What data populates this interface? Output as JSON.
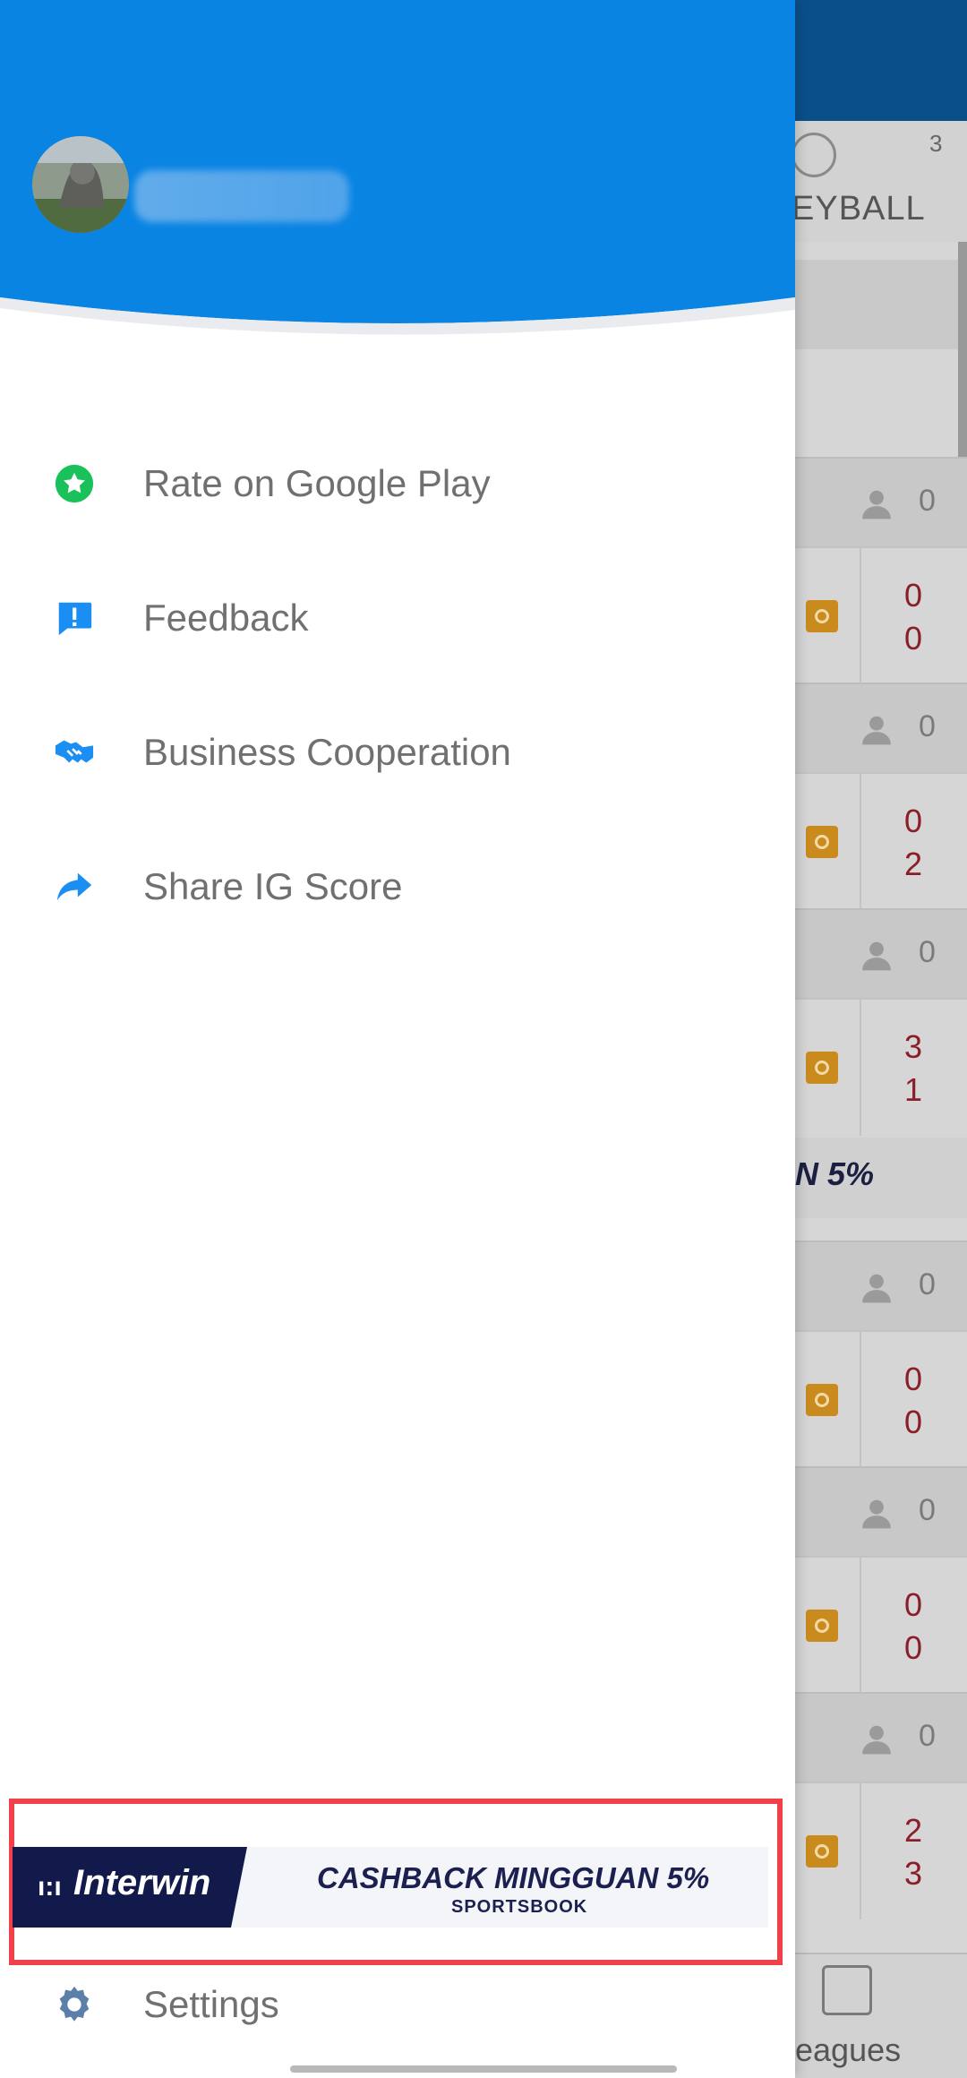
{
  "background": {
    "tab": {
      "label": "EYBALL",
      "count": "3"
    },
    "rows": [
      {
        "viewers": "0",
        "score_home": "0",
        "score_away": "0"
      },
      {
        "viewers": "0",
        "score_home": "0",
        "score_away": "2"
      },
      {
        "viewers": "0",
        "score_home": "3",
        "score_away": "1"
      },
      {
        "viewers": "0",
        "score_home": "0",
        "score_away": "0"
      },
      {
        "viewers": "0",
        "score_home": "0",
        "score_away": "0"
      },
      {
        "viewers": "0",
        "score_home": "2",
        "score_away": "3"
      }
    ],
    "ad_fragment": "N 5%",
    "bottom_nav_label": "eagues"
  },
  "drawer": {
    "menu": [
      {
        "label": "Rate on Google Play",
        "icon": "star-badge-icon"
      },
      {
        "label": "Feedback",
        "icon": "feedback-icon"
      },
      {
        "label": "Business Cooperation",
        "icon": "handshake-icon"
      },
      {
        "label": "Share IG Score",
        "icon": "share-icon"
      }
    ],
    "settings_label": "Settings",
    "ad": {
      "brand": "Interwin",
      "mark": "ı:ı",
      "headline": "CASHBACK MINGGUAN 5%",
      "sub": "SPORTSBOOK"
    }
  },
  "colors": {
    "header_blue": "#0a84e3",
    "icon_blue": "#1a8ef2",
    "star_green": "#19c15a",
    "settings_gray_blue": "#5a7fa8",
    "highlight_red": "#f0404a"
  }
}
